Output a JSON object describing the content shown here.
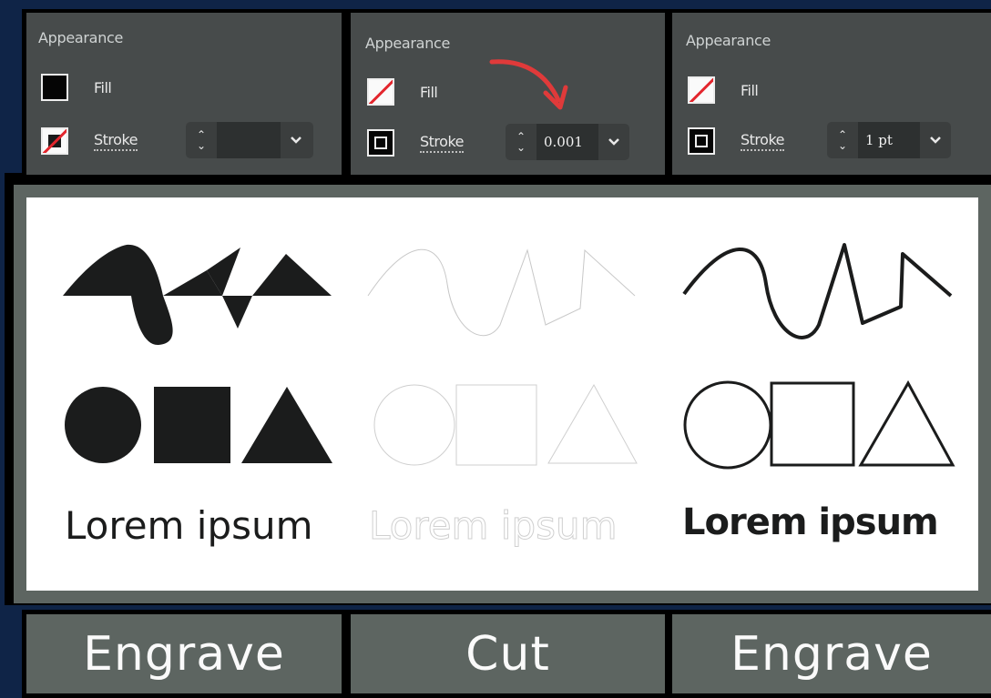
{
  "panels": [
    {
      "title": "Appearance",
      "fill_label": "Fill",
      "stroke_label": "Stroke",
      "stroke_value": ""
    },
    {
      "title": "Appearance",
      "fill_label": "Fill",
      "stroke_label": "Stroke",
      "stroke_value": "0.001"
    },
    {
      "title": "Appearance",
      "fill_label": "Fill",
      "stroke_label": "Stroke",
      "stroke_value": "1 pt"
    }
  ],
  "artboard": {
    "samples": [
      {
        "text": "Lorem ipsum",
        "style": "filled"
      },
      {
        "text": "Lorem ipsum",
        "style": "hairline"
      },
      {
        "text": "Lorem ipsum",
        "style": "outlined"
      }
    ]
  },
  "labels": [
    "Engrave",
    "Cut",
    "Engrave"
  ],
  "colors": {
    "background": "#0f2447",
    "panel": "#474b4b",
    "canvas_border": "#5d6561",
    "arrow": "#e03a3a",
    "no_color_slash": "#e3262d"
  }
}
